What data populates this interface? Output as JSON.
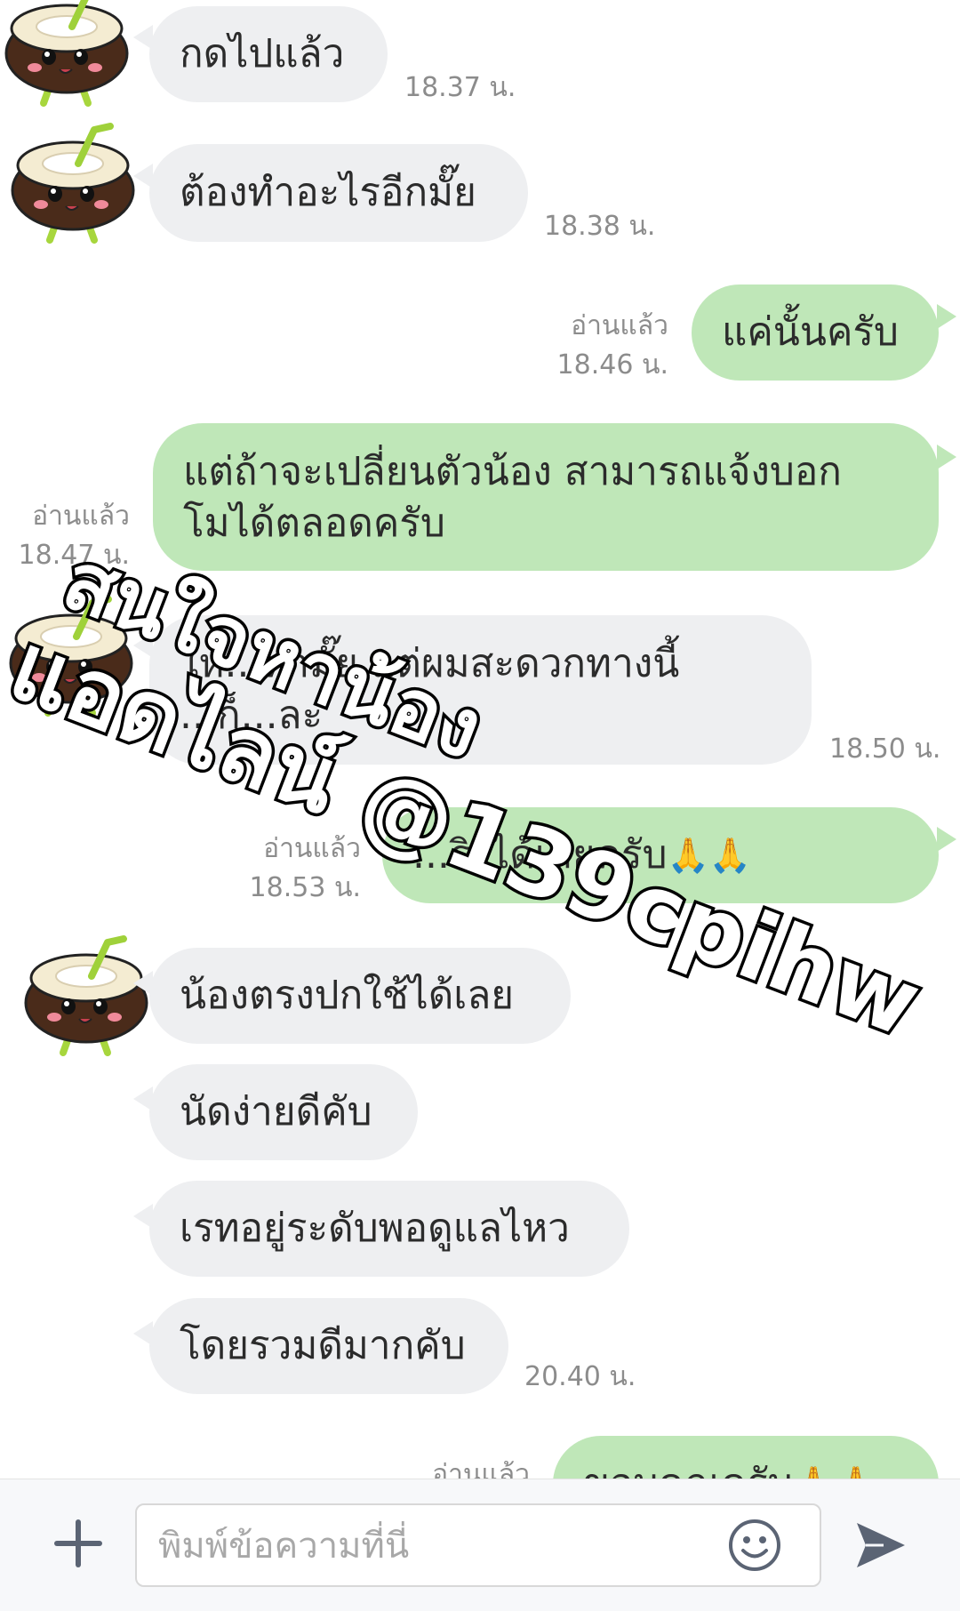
{
  "chat": {
    "messages": [
      {
        "text": "กดไปแล้ว",
        "time": "18.37 น."
      },
      {
        "text": "ต้องทำอะไรอีกมั๊ย",
        "time": "18.38 น."
      },
      {
        "text": "แค่นั้นครับ",
        "read": "อ่านแล้ว",
        "time": "18.46 น."
      },
      {
        "line1": "แต่ถ้าจะเปลี่ยนตัวน้อง สามารถแจ้งบอก",
        "line2": "โมได้ตลอดครับ",
        "read": "อ่านแล้ว",
        "time": "18.47 น."
      },
      {
        "line1": "ให้...หามั๊ย แต่ผมสะดวกทางนี้",
        "line2": "...ก็...ละ",
        "time": "18.50 น."
      },
      {
        "text": "...ริงได้เลยครับ",
        "emoji": "🙏🙏",
        "read": "อ่านแล้ว",
        "time": "18.53 น."
      },
      {
        "text": "น้องตรงปกใช้ได้เลย"
      },
      {
        "text": "นัดง่ายดีคับ"
      },
      {
        "text": "เรทอยู่ระดับพอดูแลไหว"
      },
      {
        "text": "โดยรวมดีมากคับ",
        "time": "20.40 น."
      },
      {
        "text": "ขอบคุณครับ",
        "emoji": "🙏🙏",
        "read": "อ่านแล้ว"
      }
    ]
  },
  "watermark": {
    "line1": "สนใจหาน้อง",
    "line2": "แอดไลน์ @139cpihw"
  },
  "input_bar": {
    "placeholder": "พิมพ์ข้อความที่นี่",
    "icons": [
      "plus-icon",
      "smile-icon",
      "send-icon"
    ]
  },
  "colors": {
    "incoming_bubble": "#eeeff1",
    "outgoing_bubble": "#bfe7b8",
    "meta_text": "#8c8c8c",
    "icon": "#5b6474"
  }
}
